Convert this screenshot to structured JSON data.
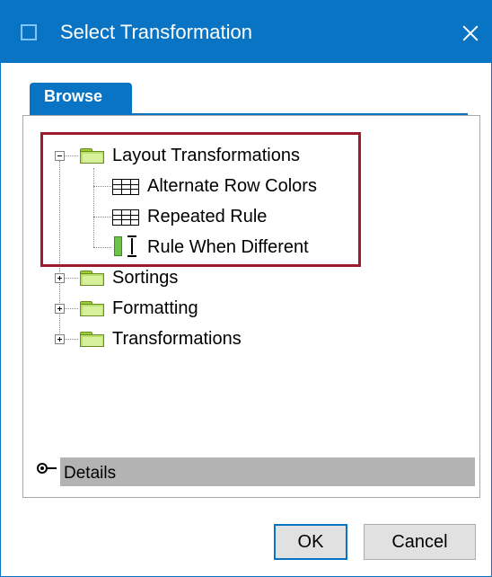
{
  "window": {
    "title": "Select Transformation",
    "accent_color": "#0a74c4",
    "icon": "app-window-icon",
    "close_icon": "close-icon"
  },
  "tabs": [
    {
      "label": "Browse",
      "selected": true
    }
  ],
  "tree": {
    "root_folders": [
      {
        "label": "Layout Transformations",
        "expanded": true,
        "icon": "folder-icon",
        "children": [
          {
            "label": "Alternate Row Colors",
            "icon": "table-grid-icon"
          },
          {
            "label": "Repeated Rule",
            "icon": "table-grid-icon"
          },
          {
            "label": "Rule When Different",
            "icon": "rule-bar-icon"
          }
        ]
      },
      {
        "label": "Sortings",
        "expanded": false,
        "icon": "folder-icon"
      },
      {
        "label": "Formatting",
        "expanded": false,
        "icon": "folder-icon"
      },
      {
        "label": "Transformations",
        "expanded": false,
        "icon": "folder-icon"
      }
    ],
    "highlight_color": "#9b1c2c"
  },
  "details": {
    "label": "Details",
    "icon": "details-toggle-icon"
  },
  "buttons": {
    "ok_label": "OK",
    "cancel_label": "Cancel"
  }
}
